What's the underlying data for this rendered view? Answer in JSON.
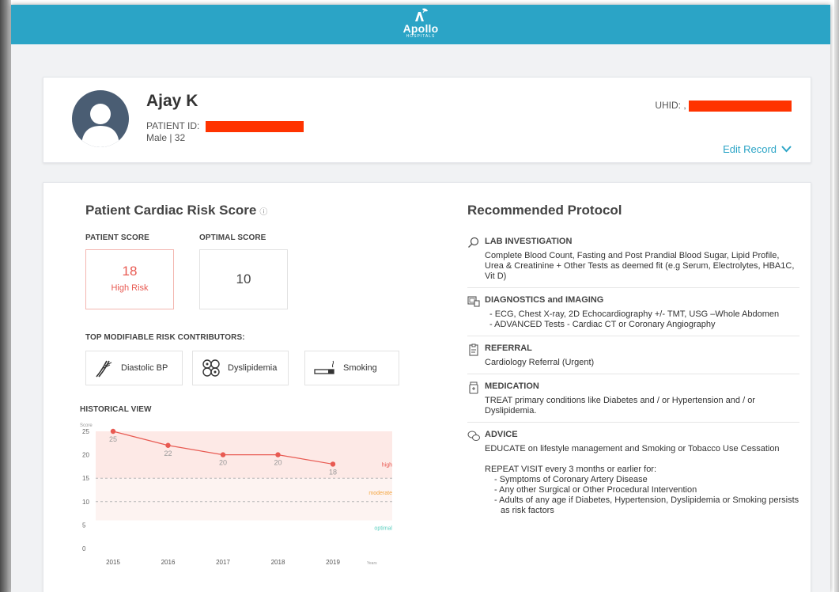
{
  "header": {
    "logo_text": "Apollo",
    "logo_subtext": "HOSPITALS",
    "brand_color": "#2ba4c6"
  },
  "patient": {
    "name": "Ajay K",
    "id_label": "PATIENT ID:",
    "gender_age": "Male | 32",
    "uhid_label": "UHID: ,",
    "edit_label": "Edit Record",
    "redaction_color": "#ff3300"
  },
  "risk": {
    "title": "Patient Cardiac Risk Score",
    "info_icon": "ⓘ",
    "patient_score_label": "PATIENT SCORE",
    "optimal_score_label": "OPTIMAL SCORE",
    "patient_score": "18",
    "patient_risk": "High Risk",
    "optimal_score": "10",
    "risk_color": "#e85a52",
    "contributors_label": "TOP MODIFIABLE RISK CONTRIBUTORS:",
    "contributors": [
      {
        "label": "Diastolic BP",
        "icon": "blood-vessel-icon"
      },
      {
        "label": "Dyslipidemia",
        "icon": "lipid-cells-icon"
      },
      {
        "label": "Smoking",
        "icon": "cigarette-icon"
      }
    ],
    "history_label": "HISTORICAL VIEW"
  },
  "chart_data": {
    "type": "line",
    "x": [
      "2015",
      "2016",
      "2017",
      "2018",
      "2019"
    ],
    "values": [
      25,
      22,
      20,
      20,
      18
    ],
    "data_labels": [
      "25",
      "22",
      "20",
      "20",
      "18"
    ],
    "ylabel": "Score",
    "xlabel": "Years",
    "ylim": [
      0,
      25
    ],
    "yticks": [
      0,
      5,
      10,
      15,
      20,
      25
    ],
    "bands": [
      {
        "name": "optimal",
        "range": [
          0,
          6
        ],
        "color": "#5ccfc0"
      },
      {
        "name": "moderate",
        "range": [
          6,
          15
        ],
        "color": "#f3a640"
      },
      {
        "name": "high",
        "range": [
          15,
          25
        ],
        "color": "#e85a52"
      }
    ],
    "threshold_lines": [
      10,
      15
    ],
    "line_color": "#e85a52"
  },
  "protocol": {
    "title": "Recommended Protocol",
    "lab": {
      "icon": "search-icon",
      "heading": "LAB INVESTIGATION",
      "text": "Complete Blood Count, Fasting and Post Prandial Blood Sugar, Lipid Profile, Urea & Creatinine + Other Tests as deemed fit (e.g Serum, Electrolytes, HBA1C, Vit D)"
    },
    "diagnostics": {
      "icon": "imaging-icon",
      "heading": "DIAGNOSTICS and IMAGING",
      "items": [
        "- ECG, Chest X-ray, 2D Echocardiography +/- TMT, USG –Whole Abdomen",
        "- ADVANCED Tests - Cardiac CT or Coronary Angiography"
      ]
    },
    "referral": {
      "icon": "clipboard-icon",
      "heading": "REFERRAL",
      "text": "Cardiology Referral (Urgent)"
    },
    "medication": {
      "icon": "pill-bottle-icon",
      "heading": "MEDICATION",
      "text": "TREAT primary conditions like Diabetes and / or Hypertension and / or Dyslipidemia."
    },
    "advice": {
      "icon": "speech-bubbles-icon",
      "heading": "ADVICE",
      "text": "EDUCATE on lifestyle management and Smoking or Tobacco Use Cessation",
      "repeat": "REPEAT VISIT every 3 months or earlier for:",
      "items": [
        "- Symptoms of Coronary Artery Disease",
        "- Any other Surgical or Other Procedural Intervention",
        "- Adults of any age if Diabetes, Hypertension, Dyslipidemia or Smoking persists as risk factors"
      ]
    }
  }
}
